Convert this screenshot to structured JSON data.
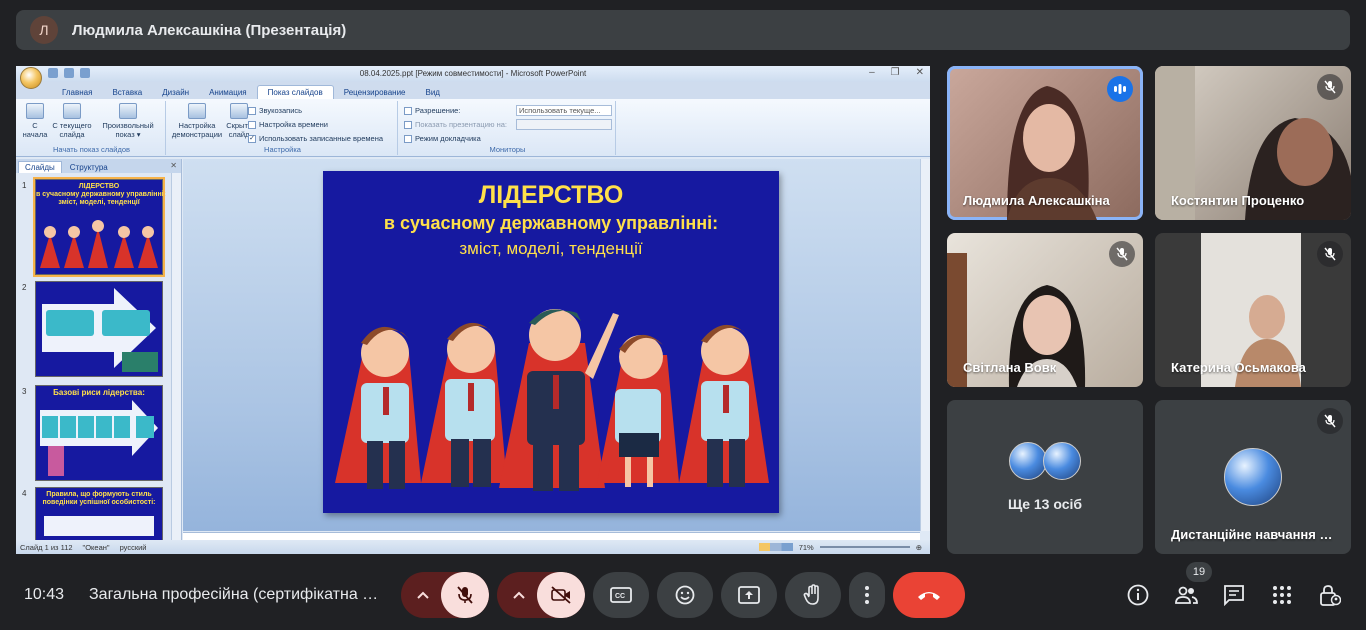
{
  "presenter_bar": {
    "avatar_letter": "Л",
    "title": "Людмила Алексашкіна (Презентація)"
  },
  "ppt": {
    "window_title": "08.04.2025.ppt [Режим совместимости] - Microsoft PowerPoint",
    "tabs": [
      "Главная",
      "Вставка",
      "Дизайн",
      "Анимация",
      "Показ слайдов",
      "Рецензирование",
      "Вид"
    ],
    "active_tab": "Показ слайдов",
    "ribbon": {
      "g1_btn1": "С\nначала",
      "g1_btn2": "С текущего\nслайда",
      "g1_btn3": "Произвольный\nпоказ ▾",
      "g1_name": "Начать показ слайдов",
      "g2_btn1": "Настройка\nдемонстрации",
      "g2_btn2": "Скрыть\nслайд",
      "g2_line1": "Звукозапись",
      "g2_line2": "Настройка времени",
      "g2_line3": "Использовать записанные времена",
      "g2_name": "Настройка",
      "g3_line1": "Разрешение:",
      "g3_line1_value": "Использовать текуще...",
      "g3_line2": "Показать презентацию на:",
      "g3_line3": "Режим докладчика",
      "g3_name": "Мониторы"
    },
    "pane_tabs": [
      "Слайды",
      "Структура"
    ],
    "thumbs": [
      {
        "num": "1",
        "title": "ЛІДЕРСТВО\nв сучасному державному управлінні:\nзміст, моделі, тенденції"
      },
      {
        "num": "2",
        "title": ""
      },
      {
        "num": "3",
        "title": "Базові риси лідерства:"
      },
      {
        "num": "4",
        "title": "Правила, що формують стиль\nповедінки успішної особистості:"
      }
    ],
    "slide": {
      "line1": "ЛІДЕРСТВО",
      "line2": "в сучасному державному управлінні:",
      "line3": "зміст, моделі, тенденції"
    },
    "status": {
      "slide": "Слайд 1 из 112",
      "theme": "\"Океан\"",
      "lang": "русский",
      "zoom": "71%"
    }
  },
  "tiles": [
    {
      "name": "Людмила Алексашкіна",
      "speaking": true
    },
    {
      "name": "Костянтин Проценко",
      "muted": true
    },
    {
      "name": "Світлана Вовк",
      "muted": true
    },
    {
      "name": "Катерина Осьмакова",
      "muted": true
    },
    {
      "name": "Ще 13 осіб"
    },
    {
      "name": "Дистанційне навчання Луганськ",
      "muted": true
    }
  ],
  "bottom": {
    "time": "10:43",
    "meeting": "Загальна професійна (сертифікатна програма)",
    "participants_count": "19"
  },
  "colors": {
    "hangup": "#ea4335",
    "accent": "#8ab4f8",
    "slide_bg": "#1619a0",
    "slide_text": "#ffe04a"
  }
}
